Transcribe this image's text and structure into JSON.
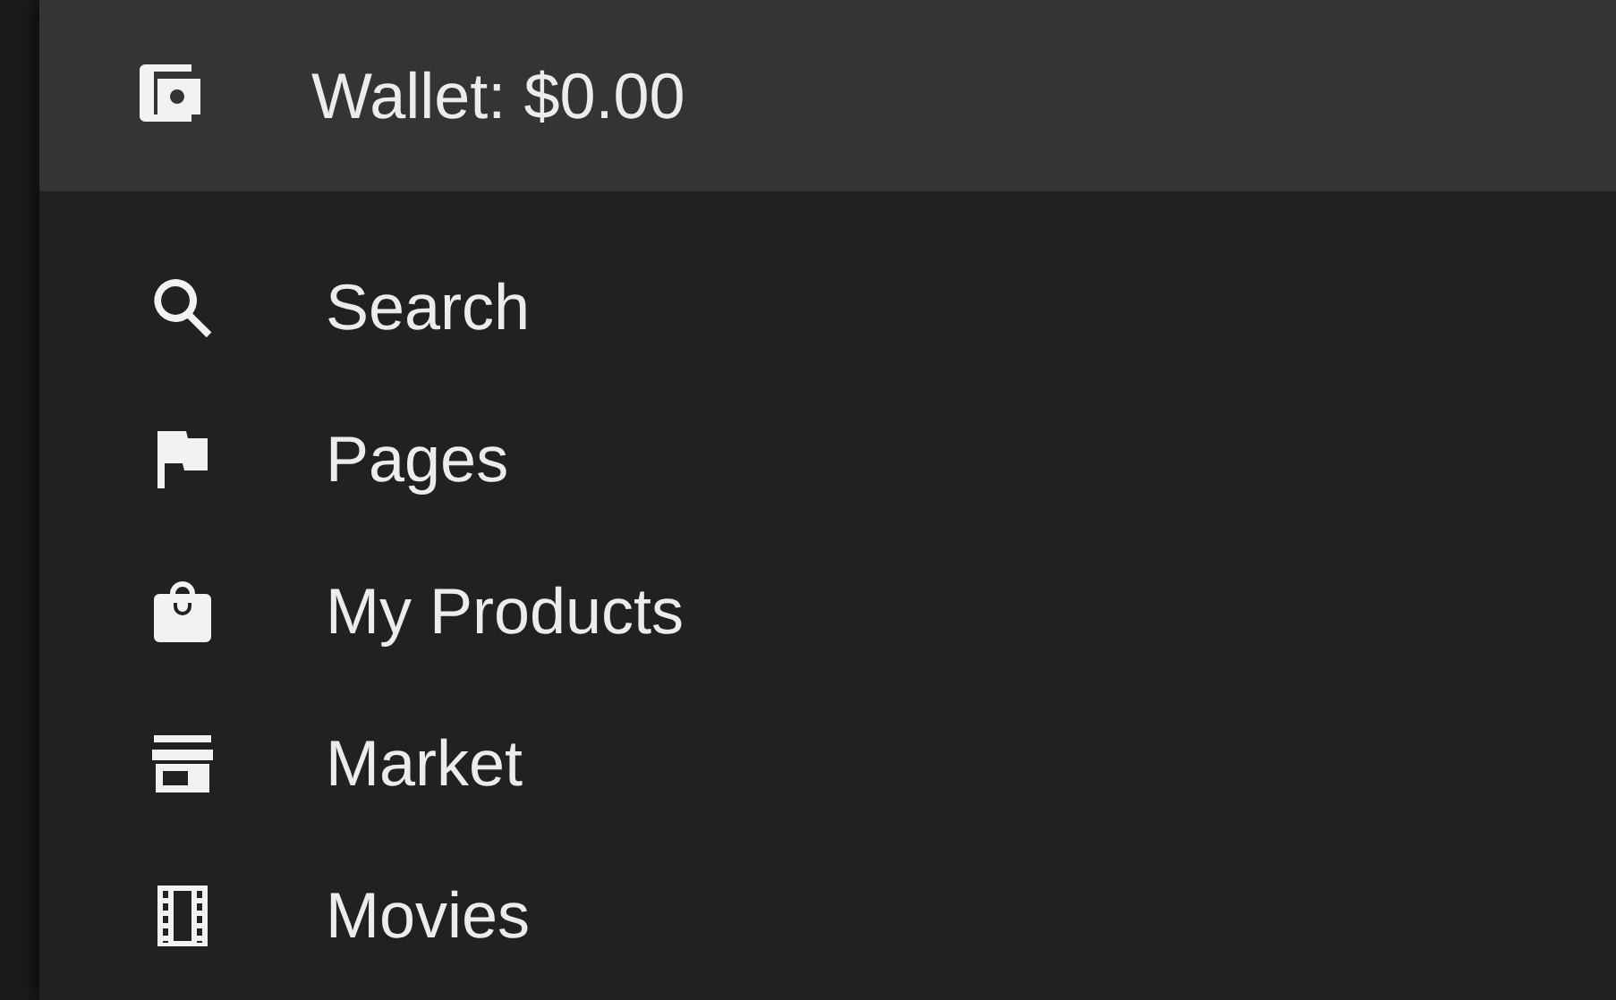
{
  "wallet": {
    "label": "Wallet: $0.00"
  },
  "menu": [
    {
      "label": "Search"
    },
    {
      "label": "Pages"
    },
    {
      "label": "My Products"
    },
    {
      "label": "Market"
    },
    {
      "label": "Movies"
    }
  ]
}
